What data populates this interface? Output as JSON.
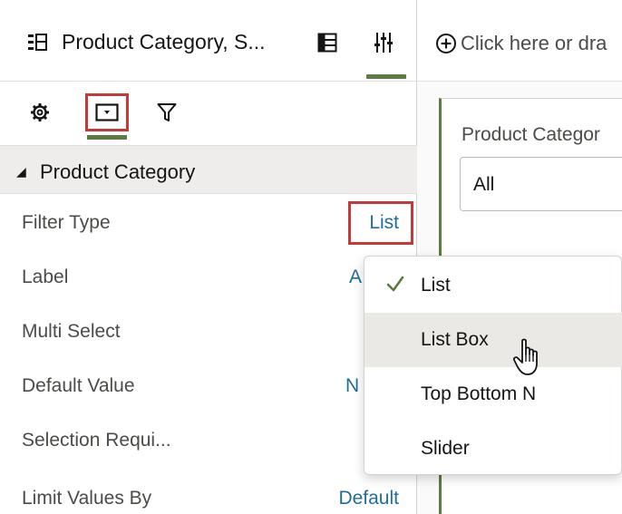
{
  "panel": {
    "title": "Product Category, S...",
    "icons": {
      "title": "filter-bar-icon",
      "grid": "grid-view-icon",
      "sliders": "properties-icon"
    }
  },
  "tabs": [
    {
      "name": "tab-general",
      "icon": "gear-icon"
    },
    {
      "name": "tab-filter-controls",
      "icon": "filter-control-icon",
      "active": true
    },
    {
      "name": "tab-filters",
      "icon": "funnel-icon"
    }
  ],
  "section": {
    "title": "Product Category"
  },
  "properties": [
    {
      "label": "Filter Type",
      "value": "List"
    },
    {
      "label": "Label",
      "value": "A"
    },
    {
      "label": "Multi Select",
      "value": ""
    },
    {
      "label": "Default Value",
      "value": "N"
    },
    {
      "label": "Selection Requi...",
      "value": ""
    },
    {
      "label": "Limit Values By",
      "value": "Default"
    }
  ],
  "canvas": {
    "drop_hint": "Click here or dra",
    "filter_label": "Product Categor",
    "filter_value": "All"
  },
  "menu": {
    "items": [
      {
        "label": "List",
        "checked": true
      },
      {
        "label": "List Box",
        "hover": true
      },
      {
        "label": "Top Bottom N"
      },
      {
        "label": "Slider"
      }
    ]
  },
  "colors": {
    "accent_green": "#5c7c41",
    "highlight_red": "#c43a3a",
    "link_blue": "#1f6e99"
  }
}
